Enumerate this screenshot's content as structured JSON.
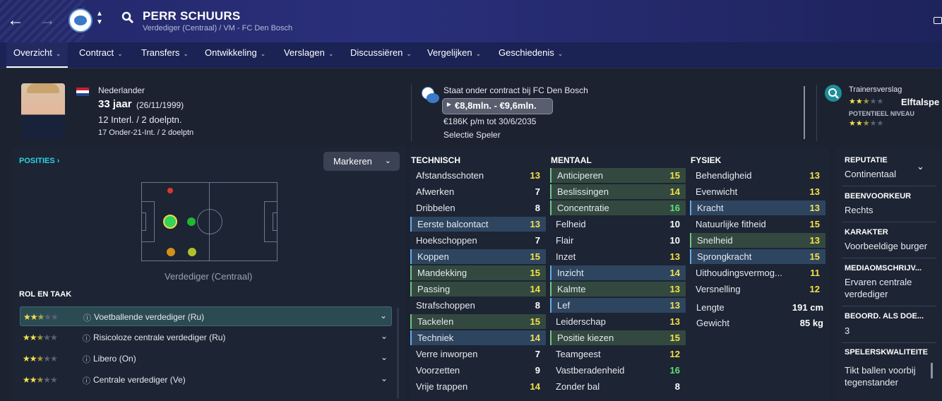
{
  "header": {
    "player_name": "PERR SCHUURS",
    "subtitle": "Verdediger (Centraal) / VM - FC Den Bosch",
    "back_icon": "arrow-left-icon",
    "forward_icon": "arrow-right-icon"
  },
  "tabs": [
    {
      "label": "Overzicht",
      "active": true
    },
    {
      "label": "Contract"
    },
    {
      "label": "Transfers"
    },
    {
      "label": "Ontwikkeling"
    },
    {
      "label": "Verslagen"
    },
    {
      "label": "Discussiëren"
    },
    {
      "label": "Vergelijken"
    },
    {
      "label": "Geschiedenis"
    }
  ],
  "profile": {
    "nationality": "Nederlander",
    "age": "33 jaar",
    "dob": "(26/11/1999)",
    "caps": "12 Interl. / 2 doelptn.",
    "u21": "17 Onder-21-Int. / 2 doelptn"
  },
  "contract": {
    "status": "Staat onder contract bij FC Den Bosch",
    "value": "€8,8mln. - €9,6mln.",
    "wage": "€186K p/m tot 30/6/2035",
    "selection": "Selectie Speler"
  },
  "report": {
    "label": "Trainersverslag",
    "current_label": "Elftalspe",
    "potential_label": "POTENTIEEL NIVEAU",
    "current_stars": 2.5,
    "potential_stars": 2.5
  },
  "positions": {
    "title": "POSITIES",
    "highlight_button": "Markeren",
    "position_name": "Verdediger (Centraal)",
    "role_title": "ROL EN TAAK",
    "roles": [
      {
        "name": "Voetballende verdediger (Ru)",
        "stars": 2.5
      },
      {
        "name": "Risicoloze centrale verdediger (Ru)",
        "stars": 2.5
      },
      {
        "name": "Libero (On)",
        "stars": 2.5
      },
      {
        "name": "Centrale verdediger (Ve)",
        "stars": 2.5
      }
    ]
  },
  "technisch": {
    "title": "TECHNISCH",
    "rows": [
      {
        "label": "Afstandsschoten",
        "value": "13",
        "hl": ""
      },
      {
        "label": "Afwerken",
        "value": "7",
        "hl": ""
      },
      {
        "label": "Dribbelen",
        "value": "8",
        "hl": ""
      },
      {
        "label": "Eerste balcontact",
        "value": "13",
        "hl": "b"
      },
      {
        "label": "Hoekschoppen",
        "value": "7",
        "hl": ""
      },
      {
        "label": "Koppen",
        "value": "15",
        "hl": "b"
      },
      {
        "label": "Mandekking",
        "value": "15",
        "hl": "g"
      },
      {
        "label": "Passing",
        "value": "14",
        "hl": "g"
      },
      {
        "label": "Strafschoppen",
        "value": "8",
        "hl": ""
      },
      {
        "label": "Tackelen",
        "value": "15",
        "hl": "g"
      },
      {
        "label": "Techniek",
        "value": "14",
        "hl": "b"
      },
      {
        "label": "Verre inworpen",
        "value": "7",
        "hl": ""
      },
      {
        "label": "Voorzetten",
        "value": "9",
        "hl": ""
      },
      {
        "label": "Vrije trappen",
        "value": "14",
        "hl": ""
      }
    ]
  },
  "mentaal": {
    "title": "MENTAAL",
    "rows": [
      {
        "label": "Anticiperen",
        "value": "15",
        "hl": "g"
      },
      {
        "label": "Beslissingen",
        "value": "14",
        "hl": "g"
      },
      {
        "label": "Concentratie",
        "value": "16",
        "hl": "g"
      },
      {
        "label": "Felheid",
        "value": "10",
        "hl": ""
      },
      {
        "label": "Flair",
        "value": "10",
        "hl": ""
      },
      {
        "label": "Inzet",
        "value": "13",
        "hl": ""
      },
      {
        "label": "Inzicht",
        "value": "14",
        "hl": "b"
      },
      {
        "label": "Kalmte",
        "value": "13",
        "hl": "g"
      },
      {
        "label": "Lef",
        "value": "13",
        "hl": "b"
      },
      {
        "label": "Leiderschap",
        "value": "13",
        "hl": ""
      },
      {
        "label": "Positie kiezen",
        "value": "15",
        "hl": "g"
      },
      {
        "label": "Teamgeest",
        "value": "12",
        "hl": ""
      },
      {
        "label": "Vastberadenheid",
        "value": "16",
        "hl": ""
      },
      {
        "label": "Zonder bal",
        "value": "8",
        "hl": ""
      }
    ]
  },
  "fysiek": {
    "title": "FYSIEK",
    "rows": [
      {
        "label": "Behendigheid",
        "value": "13",
        "hl": ""
      },
      {
        "label": "Evenwicht",
        "value": "13",
        "hl": ""
      },
      {
        "label": "Kracht",
        "value": "13",
        "hl": "b"
      },
      {
        "label": "Natuurlijke fitheid",
        "value": "15",
        "hl": ""
      },
      {
        "label": "Snelheid",
        "value": "13",
        "hl": "g"
      },
      {
        "label": "Sprongkracht",
        "value": "15",
        "hl": "b"
      },
      {
        "label": "Uithoudingsvermog...",
        "value": "11",
        "hl": ""
      },
      {
        "label": "Versnelling",
        "value": "12",
        "hl": ""
      }
    ],
    "length_label": "Lengte",
    "length": "191 cm",
    "weight_label": "Gewicht",
    "weight": "85 kg"
  },
  "info_panel": {
    "reputation_h": "REPUTATIE",
    "reputation": "Continentaal",
    "foot_h": "BEENVOORKEUR",
    "foot": "Rechts",
    "character_h": "KARAKTER",
    "character": "Voorbeeldige burger",
    "media_h": "MEDIAOMSCHRIJV...",
    "media_1": "Ervaren centrale",
    "media_2": "verdediger",
    "doe_h": "BEOORD. ALS DOE...",
    "doe": "3",
    "quality_h": "SPELERSKWALITEITE",
    "quality_1": "Tikt ballen voorbij",
    "quality_2": "tegenstander"
  },
  "colors": {
    "high": "#f5e24a",
    "top": "#5ee07c",
    "normal": "#ffffff"
  }
}
